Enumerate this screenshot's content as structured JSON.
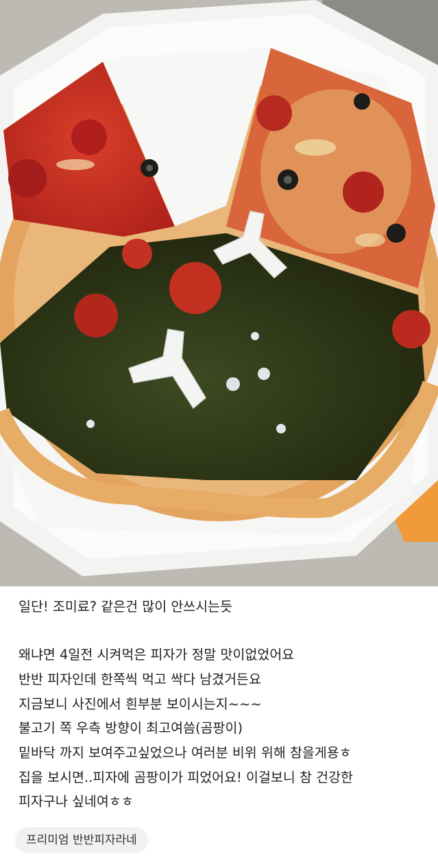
{
  "post": {
    "lines": [
      "일단! 조미료? 같은건 많이 안쓰시는듯",
      "왜냐면 4일전 시켜먹은 피자가 정말 맛이없었어요",
      "반반 피자인데 한쪽씩 먹고 싹다 남겼거든요",
      "지금보니 사진에서 흰부분 보이시는지~~~",
      "불고기 쪽 우측 방향이 최고여씀(곰팡이)",
      "밑바닥 까지 보여주고싶었으나 여러분 비위 위해 참을게용ㅎ",
      "집을 보시면..피자에 곰팡이가 피었어요!  이걸보니 참 건강한",
      "피자구나 싶네여ㅎㅎ"
    ],
    "tag": "프리미엄 반반피자라네"
  },
  "colors": {
    "text": "#222222",
    "tag_background": "#f1f1f1"
  }
}
